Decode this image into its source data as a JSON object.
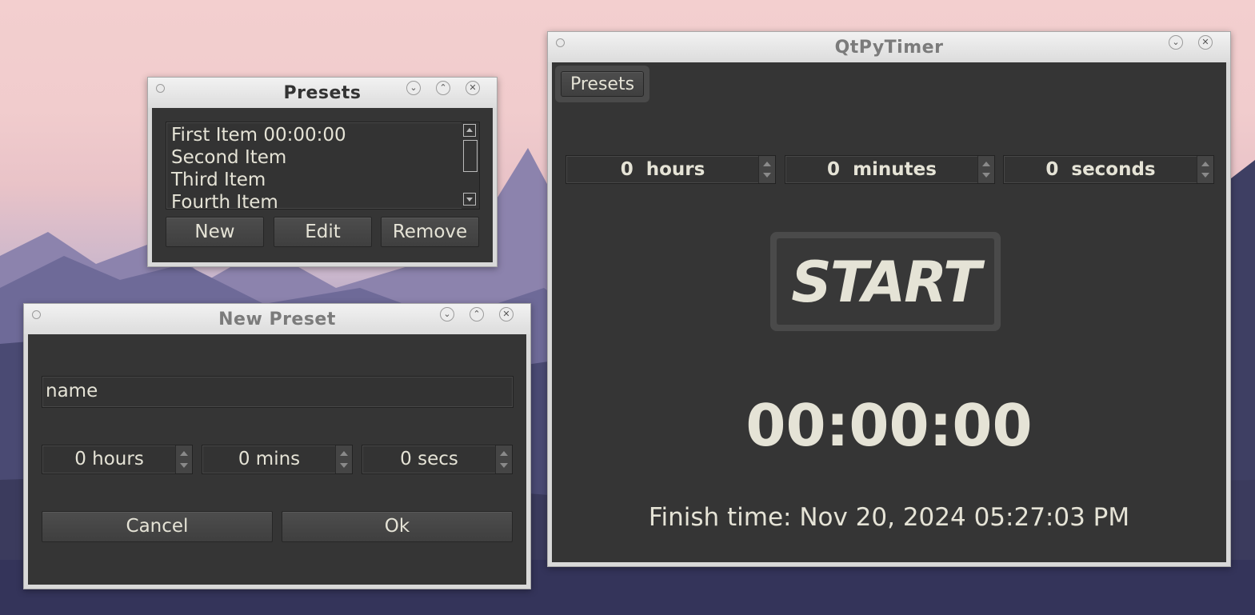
{
  "presets_window": {
    "title": "Presets",
    "items": [
      "First Item 00:00:00",
      "Second Item",
      "Third Item",
      "Fourth Item"
    ],
    "new_label": "New",
    "edit_label": "Edit",
    "remove_label": "Remove"
  },
  "new_preset_window": {
    "title": "New Preset",
    "name_value": "name",
    "hours_value": "0 hours",
    "mins_value": "0 mins",
    "secs_value": "0 secs",
    "cancel_label": "Cancel",
    "ok_label": "Ok"
  },
  "timer_window": {
    "title": "QtPyTimer",
    "presets_button": "Presets",
    "hours_value": "0",
    "hours_suffix": "hours",
    "minutes_value": "0",
    "minutes_suffix": "minutes",
    "seconds_value": "0",
    "seconds_suffix": "seconds",
    "start_label": "START",
    "countdown": "00:00:00",
    "finish_time": "Finish time: Nov 20, 2024 05:27:03 PM"
  },
  "colors": {
    "client_bg": "#353535",
    "text": "#e5e3d6",
    "title_active": "#333333",
    "title_inactive": "#7b7b7b"
  },
  "icons": [
    "minimize-icon",
    "maximize-icon",
    "close-icon",
    "scroll-up-icon",
    "scroll-down-icon",
    "spin-up-icon",
    "spin-down-icon"
  ]
}
